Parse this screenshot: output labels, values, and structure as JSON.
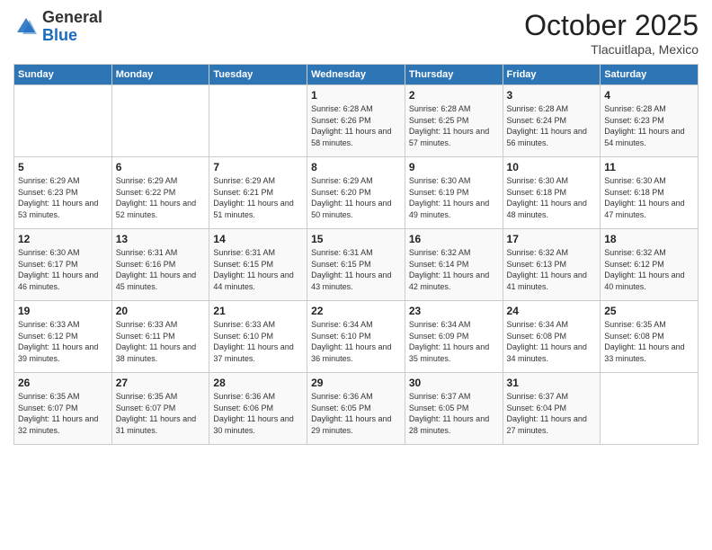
{
  "header": {
    "logo_general": "General",
    "logo_blue": "Blue",
    "month_title": "October 2025",
    "location": "Tlacuitlapa, Mexico"
  },
  "weekdays": [
    "Sunday",
    "Monday",
    "Tuesday",
    "Wednesday",
    "Thursday",
    "Friday",
    "Saturday"
  ],
  "weeks": [
    [
      {
        "day": "",
        "info": ""
      },
      {
        "day": "",
        "info": ""
      },
      {
        "day": "",
        "info": ""
      },
      {
        "day": "1",
        "info": "Sunrise: 6:28 AM\nSunset: 6:26 PM\nDaylight: 11 hours\nand 58 minutes."
      },
      {
        "day": "2",
        "info": "Sunrise: 6:28 AM\nSunset: 6:25 PM\nDaylight: 11 hours\nand 57 minutes."
      },
      {
        "day": "3",
        "info": "Sunrise: 6:28 AM\nSunset: 6:24 PM\nDaylight: 11 hours\nand 56 minutes."
      },
      {
        "day": "4",
        "info": "Sunrise: 6:28 AM\nSunset: 6:23 PM\nDaylight: 11 hours\nand 54 minutes."
      }
    ],
    [
      {
        "day": "5",
        "info": "Sunrise: 6:29 AM\nSunset: 6:23 PM\nDaylight: 11 hours\nand 53 minutes."
      },
      {
        "day": "6",
        "info": "Sunrise: 6:29 AM\nSunset: 6:22 PM\nDaylight: 11 hours\nand 52 minutes."
      },
      {
        "day": "7",
        "info": "Sunrise: 6:29 AM\nSunset: 6:21 PM\nDaylight: 11 hours\nand 51 minutes."
      },
      {
        "day": "8",
        "info": "Sunrise: 6:29 AM\nSunset: 6:20 PM\nDaylight: 11 hours\nand 50 minutes."
      },
      {
        "day": "9",
        "info": "Sunrise: 6:30 AM\nSunset: 6:19 PM\nDaylight: 11 hours\nand 49 minutes."
      },
      {
        "day": "10",
        "info": "Sunrise: 6:30 AM\nSunset: 6:18 PM\nDaylight: 11 hours\nand 48 minutes."
      },
      {
        "day": "11",
        "info": "Sunrise: 6:30 AM\nSunset: 6:18 PM\nDaylight: 11 hours\nand 47 minutes."
      }
    ],
    [
      {
        "day": "12",
        "info": "Sunrise: 6:30 AM\nSunset: 6:17 PM\nDaylight: 11 hours\nand 46 minutes."
      },
      {
        "day": "13",
        "info": "Sunrise: 6:31 AM\nSunset: 6:16 PM\nDaylight: 11 hours\nand 45 minutes."
      },
      {
        "day": "14",
        "info": "Sunrise: 6:31 AM\nSunset: 6:15 PM\nDaylight: 11 hours\nand 44 minutes."
      },
      {
        "day": "15",
        "info": "Sunrise: 6:31 AM\nSunset: 6:15 PM\nDaylight: 11 hours\nand 43 minutes."
      },
      {
        "day": "16",
        "info": "Sunrise: 6:32 AM\nSunset: 6:14 PM\nDaylight: 11 hours\nand 42 minutes."
      },
      {
        "day": "17",
        "info": "Sunrise: 6:32 AM\nSunset: 6:13 PM\nDaylight: 11 hours\nand 41 minutes."
      },
      {
        "day": "18",
        "info": "Sunrise: 6:32 AM\nSunset: 6:12 PM\nDaylight: 11 hours\nand 40 minutes."
      }
    ],
    [
      {
        "day": "19",
        "info": "Sunrise: 6:33 AM\nSunset: 6:12 PM\nDaylight: 11 hours\nand 39 minutes."
      },
      {
        "day": "20",
        "info": "Sunrise: 6:33 AM\nSunset: 6:11 PM\nDaylight: 11 hours\nand 38 minutes."
      },
      {
        "day": "21",
        "info": "Sunrise: 6:33 AM\nSunset: 6:10 PM\nDaylight: 11 hours\nand 37 minutes."
      },
      {
        "day": "22",
        "info": "Sunrise: 6:34 AM\nSunset: 6:10 PM\nDaylight: 11 hours\nand 36 minutes."
      },
      {
        "day": "23",
        "info": "Sunrise: 6:34 AM\nSunset: 6:09 PM\nDaylight: 11 hours\nand 35 minutes."
      },
      {
        "day": "24",
        "info": "Sunrise: 6:34 AM\nSunset: 6:08 PM\nDaylight: 11 hours\nand 34 minutes."
      },
      {
        "day": "25",
        "info": "Sunrise: 6:35 AM\nSunset: 6:08 PM\nDaylight: 11 hours\nand 33 minutes."
      }
    ],
    [
      {
        "day": "26",
        "info": "Sunrise: 6:35 AM\nSunset: 6:07 PM\nDaylight: 11 hours\nand 32 minutes."
      },
      {
        "day": "27",
        "info": "Sunrise: 6:35 AM\nSunset: 6:07 PM\nDaylight: 11 hours\nand 31 minutes."
      },
      {
        "day": "28",
        "info": "Sunrise: 6:36 AM\nSunset: 6:06 PM\nDaylight: 11 hours\nand 30 minutes."
      },
      {
        "day": "29",
        "info": "Sunrise: 6:36 AM\nSunset: 6:05 PM\nDaylight: 11 hours\nand 29 minutes."
      },
      {
        "day": "30",
        "info": "Sunrise: 6:37 AM\nSunset: 6:05 PM\nDaylight: 11 hours\nand 28 minutes."
      },
      {
        "day": "31",
        "info": "Sunrise: 6:37 AM\nSunset: 6:04 PM\nDaylight: 11 hours\nand 27 minutes."
      },
      {
        "day": "",
        "info": ""
      }
    ]
  ]
}
